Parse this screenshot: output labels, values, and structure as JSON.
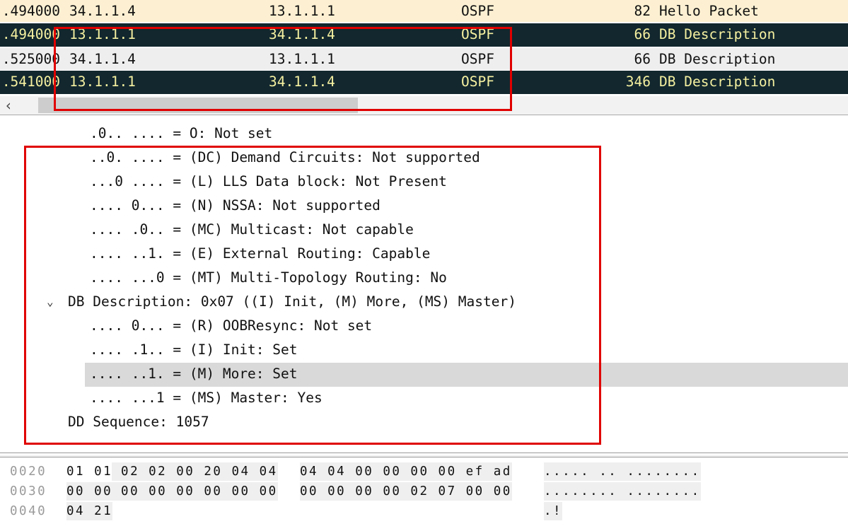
{
  "packet_list": [
    {
      "time": ".494000",
      "source": "34.1.1.4",
      "destination": "13.1.1.1",
      "protocol": "OSPF",
      "length": "82",
      "info": "Hello Packet",
      "style": "normal"
    },
    {
      "time": ".494000",
      "source": "13.1.1.1",
      "destination": "34.1.1.4",
      "protocol": "OSPF",
      "length": "66",
      "info": "DB Description",
      "style": "dark"
    },
    {
      "time": ".525000",
      "source": "34.1.1.4",
      "destination": "13.1.1.1",
      "protocol": "OSPF",
      "length": "66",
      "info": "DB Description",
      "style": "light"
    },
    {
      "time": ".541000",
      "source": "13.1.1.1",
      "destination": "34.1.1.4",
      "protocol": "OSPF",
      "length": "346",
      "info": "DB Description",
      "style": "dark"
    }
  ],
  "scroll_left_icon": "chevron-left-icon",
  "details": [
    ".0.. .... = O: Not set",
    "..0. .... = (DC) Demand Circuits: Not supported",
    "...0 .... = (L) LLS Data block: Not Present",
    ".... 0... = (N) NSSA: Not supported",
    ".... .0.. = (MC) Multicast: Not capable",
    ".... ..1. = (E) External Routing: Capable",
    ".... ...0 = (MT) Multi-Topology Routing: No",
    "DB Description: 0x07 ((I) Init, (M) More, (MS) Master)",
    ".... 0... = (R) OOBResync: Not set",
    ".... .1.. = (I) Init: Set",
    ".... ..1. = (M) More: Set",
    ".... ...1 = (MS) Master: Yes",
    "DD Sequence: 1057"
  ],
  "expand_icon": "chevron-down-icon",
  "hex": [
    {
      "offset": "0020",
      "a1": "01 01",
      "a2": " 02 02 00 20 04 04",
      "b": "04 04 00 00 00 00 ef ad",
      "ascii": "..... .. ........"
    },
    {
      "offset": "0030",
      "a1": "00 00",
      "a2": " 00 00 00 00 00 00",
      "b": "00 00 00 00 02 07 00 00",
      "ascii": "........ ........"
    },
    {
      "offset": "0040",
      "a1": "04 21",
      "a2": "",
      "b": "",
      "ascii": ".!"
    }
  ],
  "colors": {
    "highlight_box": "#e00000",
    "dark_row_bg": "#12272e",
    "dark_row_text": "#f5f0a0",
    "hello_row_bg": "#fdf0d2"
  }
}
